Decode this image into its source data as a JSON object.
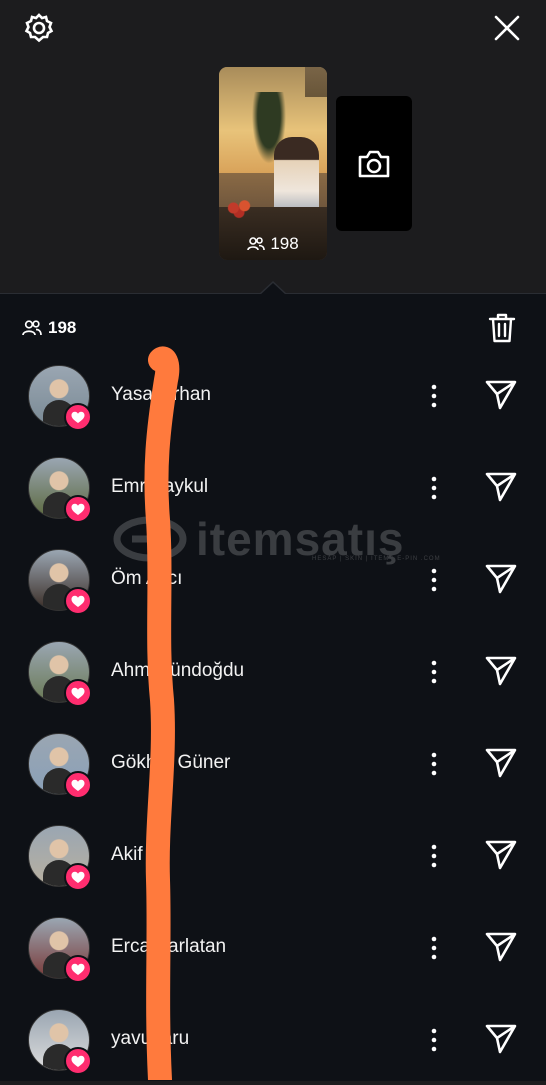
{
  "top": {
    "settings_icon": "gear-icon",
    "close_icon": "close-icon",
    "story_viewers": "198",
    "add_story_icon": "camera-icon"
  },
  "sheet": {
    "viewer_count": "198",
    "delete_icon": "trash-icon"
  },
  "viewers": [
    {
      "name": "Yasa  Orhan",
      "avatar_bg": "#7a8a95"
    },
    {
      "name": "Emr    Baykul",
      "avatar_bg": "#5c6a3e"
    },
    {
      "name": "Öm    Avcı",
      "avatar_bg": "#3a2c25"
    },
    {
      "name": "Ahm   Gündoğdu",
      "avatar_bg": "#6a7a55"
    },
    {
      "name": "Gökh   n Güner",
      "avatar_bg": "#8aa0b8"
    },
    {
      "name": "Akif",
      "avatar_bg": "#b8b0a0"
    },
    {
      "name": "Erca    Parlatan",
      "avatar_bg": "#7a3a38"
    },
    {
      "name": "yavu    taru",
      "avatar_bg": "#dcdcdc"
    }
  ],
  "watermark": {
    "text": "itemsatış",
    "sub": "HESAP | SKIN | ITEM | E-PIN .COM"
  },
  "colors": {
    "heart": "#ff2d6f",
    "stroke": "#ff7a3d",
    "sheet_bg": "#0e1116"
  }
}
